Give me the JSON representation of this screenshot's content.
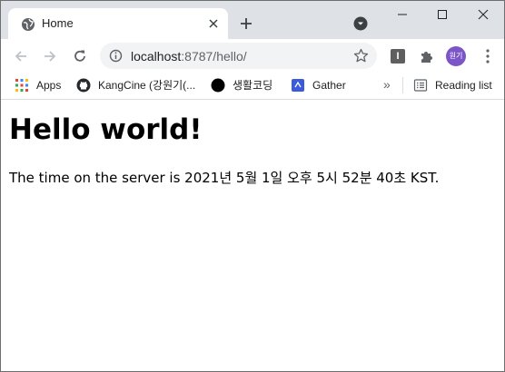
{
  "tab": {
    "title": "Home",
    "favicon_icon": "globe-icon"
  },
  "window_controls": {
    "minimize_icon": "minimize-icon",
    "maximize_icon": "maximize-icon",
    "close_icon": "close-icon"
  },
  "omnibox": {
    "host": "localhost",
    "rest": ":8787/hello/"
  },
  "toolbar": {
    "extension_i_label": "I",
    "avatar_label": "원기"
  },
  "bookmarks": {
    "items": [
      {
        "label": "Apps",
        "icon": "apps-grid-icon"
      },
      {
        "label": "KangCine (강원기(...",
        "icon": "github-icon"
      },
      {
        "label": "생활코딩",
        "icon": "black-circle-icon"
      },
      {
        "label": "Gather",
        "icon": "gather-icon"
      }
    ],
    "more_label": "»",
    "reading_list_label": "Reading list"
  },
  "page": {
    "heading": "Hello world!",
    "text": "The time on the server is 2021년 5월 1일 오후 5시 52분 40초 KST."
  },
  "colors": {
    "tabstrip": "#dee1e6",
    "omnibox_bg": "#f1f3f4",
    "avatar_bg": "#7c56c8",
    "gather_blue": "#3b5bdb"
  }
}
